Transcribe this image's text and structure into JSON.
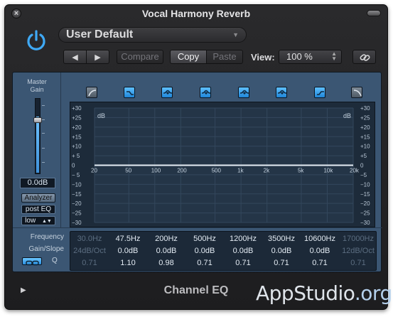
{
  "window": {
    "title": "Vocal Harmony Reverb"
  },
  "preset": {
    "name": "User Default"
  },
  "toolbar": {
    "prev_icon": "◀",
    "next_icon": "▶",
    "compare_label": "Compare",
    "copy_label": "Copy",
    "paste_label": "Paste",
    "view_label": "View:",
    "view_value": "100 %"
  },
  "master": {
    "label_line1": "Master",
    "label_line2": "Gain",
    "value": "0.0dB",
    "level_fraction": 0.25,
    "analyzer_label": "Analyzer",
    "post_eq_label": "post EQ",
    "resolution_label": "low"
  },
  "graph": {
    "left_db_ticks": [
      "+30",
      "+25",
      "+20",
      "+15",
      "+10",
      "+ 5",
      "0",
      "− 5",
      "−10",
      "−15",
      "−20",
      "−25",
      "−30"
    ],
    "right_db_ticks": [
      "+30",
      "+25",
      "+20",
      "+15",
      "+10",
      "+5",
      "0",
      "−5",
      "−10",
      "−15",
      "−20",
      "−25",
      "−30"
    ],
    "db_unit": "dB",
    "freq_labels": [
      "20",
      "50",
      "100",
      "200",
      "500",
      "1k",
      "2k",
      "5k",
      "10k",
      "20k"
    ]
  },
  "bands": [
    {
      "type": "low-cut",
      "on": false
    },
    {
      "type": "low-shelf",
      "on": true
    },
    {
      "type": "peak",
      "on": true
    },
    {
      "type": "peak",
      "on": true
    },
    {
      "type": "peak",
      "on": true
    },
    {
      "type": "peak",
      "on": true
    },
    {
      "type": "high-shelf",
      "on": true
    },
    {
      "type": "high-cut",
      "on": false
    }
  ],
  "params": {
    "labels": {
      "frequency": "Frequency",
      "gain_slope": "Gain/Slope",
      "q": "Q"
    },
    "columns": [
      {
        "freq": "30.0Hz",
        "gain": "24dB/Oct",
        "q": "0.71",
        "dim": true
      },
      {
        "freq": "47.5Hz",
        "gain": "0.0dB",
        "q": "1.10",
        "dim": false
      },
      {
        "freq": "200Hz",
        "gain": "0.0dB",
        "q": "0.98",
        "dim": false
      },
      {
        "freq": "500Hz",
        "gain": "0.0dB",
        "q": "0.71",
        "dim": false
      },
      {
        "freq": "1200Hz",
        "gain": "0.0dB",
        "q": "0.71",
        "dim": false
      },
      {
        "freq": "3500Hz",
        "gain": "0.0dB",
        "q": "0.71",
        "dim": false
      },
      {
        "freq": "10600Hz",
        "gain": "0.0dB",
        "q": "0.71",
        "dim": false
      },
      {
        "freq": "17000Hz",
        "gain": "12dB/Oct",
        "q": "0.71",
        "dim": true
      }
    ]
  },
  "footer": {
    "plugin_name": "Channel EQ"
  },
  "watermark": {
    "brand": "AppStudio",
    "tld": ".org"
  },
  "colors": {
    "accent": "#3fa9f5",
    "panel": "#3b5673"
  }
}
